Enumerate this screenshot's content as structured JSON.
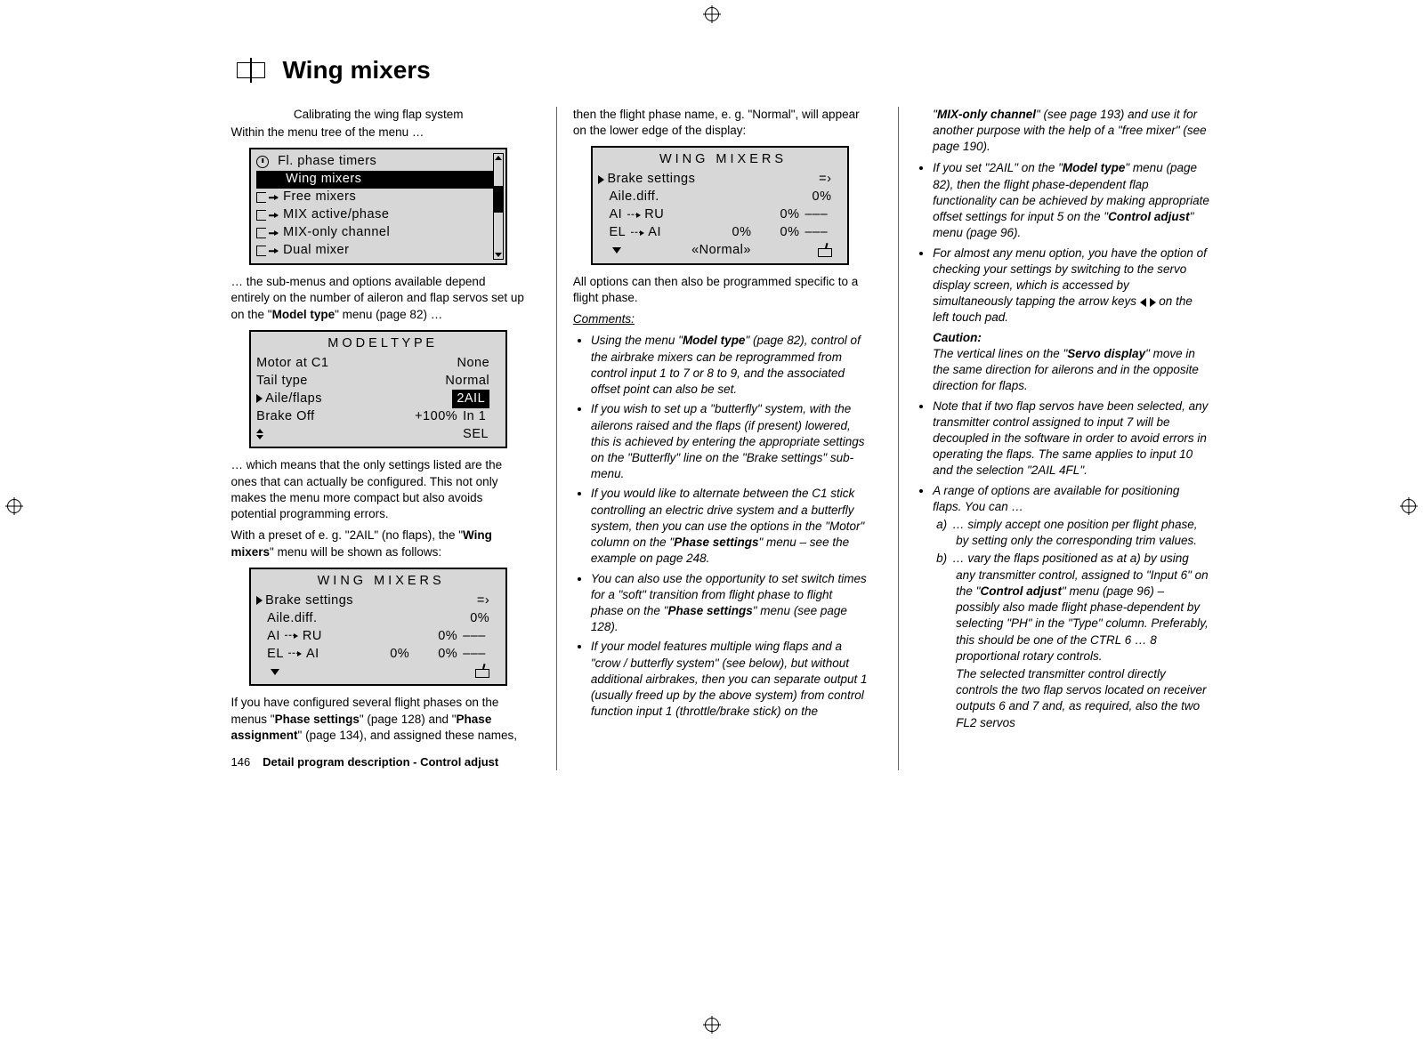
{
  "page": {
    "title": "Wing mixers",
    "subtitle": "Calibrating the wing flap system",
    "footer_page": "146",
    "footer_text": "Detail program description - Control adjust"
  },
  "col1": {
    "intro": "Within the menu tree of the menu …",
    "menu": {
      "items": [
        "Fl. phase timers",
        "Wing mixers",
        "Free mixers",
        "MIX active/phase",
        "MIX-only channel",
        "Dual mixer"
      ]
    },
    "after_menu_1": "… the sub-menus and options available depend entirely on the number of aileron and flap servos set up on the \"",
    "after_menu_1_bold": "Model type",
    "after_menu_1_end": "\" menu (page 82) …",
    "model_type": {
      "title": "M O D E L  T Y P E",
      "rows": [
        {
          "label": "Motor at C1",
          "val": "None"
        },
        {
          "label": "Tail  type",
          "val": "Normal"
        },
        {
          "label": "Aile/flaps",
          "val": "2AIL",
          "selected": true,
          "boxed": true
        },
        {
          "label": "Brake Off",
          "val": "+100%",
          "sw": "In 1"
        },
        {
          "label": "",
          "val": "",
          "sw": "SEL",
          "updn": true
        }
      ]
    },
    "after_model_1": "… which means that the only settings listed are the ones that can actually be configured. This not only makes the menu more compact but also avoids potential programming errors.",
    "after_model_2a": "With a preset of e. g. \"2AIL\" (no flaps), the \"",
    "after_model_2b": "Wing mixers",
    "after_model_2c": "\" menu will be shown as follows:",
    "wing1": {
      "title": "WING  MIXERS",
      "rows": [
        {
          "sel": true,
          "label": "Brake settings",
          "val": "",
          "arrow": true
        },
        {
          "label": "Aile.diff.",
          "val": "0%"
        },
        {
          "label": "AI",
          "to": "RU",
          "val": "0%",
          "dash": "–––"
        },
        {
          "label": "EL",
          "to": "AI",
          "mid": "0%",
          "val": "0%",
          "dash": "–––"
        },
        {
          "foot": true
        }
      ]
    },
    "tail_a": "If you have configured several flight phases on the menus \"",
    "tail_b": "Phase settings",
    "tail_c": "\" (page 128) and \"",
    "tail_d": "Phase assignment",
    "tail_e": "\" (page 134), and assigned these names,"
  },
  "col2": {
    "intro": "then the flight phase name, e. g. \"Normal\", will appear on the lower edge of the display:",
    "wing2": {
      "title": "WING  MIXERS",
      "rows": [
        {
          "sel": true,
          "label": "Brake settings",
          "val": "",
          "arrow": true
        },
        {
          "label": "Aile.diff.",
          "val": "0%"
        },
        {
          "label": "AI",
          "to": "RU",
          "val": "0%",
          "dash": "–––"
        },
        {
          "label": "EL",
          "to": "AI",
          "mid": "0%",
          "val": "0%",
          "dash": "–––"
        },
        {
          "foot": true,
          "footlabel": "«Normal»"
        }
      ]
    },
    "after": "All options can then also be programmed specific to a flight phase.",
    "comments_hdr": "Comments:",
    "bullets": [
      {
        "pre": "Using the menu \"",
        "bold": "Model type",
        "post": "\" (page 82), control of the airbrake mixers can be reprogrammed from control input 1 to 7 or 8 to 9, and the associated offset point can also be set."
      },
      {
        "plain": "If you wish to set up a \"butterfly\" system, with the ailerons raised and the flaps (if present) lowered, this is achieved by entering the appropriate settings on the \"Butterfly\" line on the \"Brake settings\" sub-menu."
      },
      {
        "pre": "If you would like to alternate between the C1 stick controlling an electric drive system and a butterfly system, then you can use the options in the \"Motor\" column on the \"",
        "bold": "Phase settings",
        "post": "\" menu – see the example on page 248."
      },
      {
        "pre": "You can also use the opportunity to set switch times for a \"soft\" transition from flight phase to flight phase on the \"",
        "bold": "Phase settings",
        "post": "\" menu (see page 128)."
      },
      {
        "plain": "If your model features multiple wing flaps and a \"crow / butterfly system\" (see below), but without additional airbrakes, then you can separate output 1 (usually freed up by the above system) from control function input 1 (throttle/brake stick) on the"
      }
    ]
  },
  "col3": {
    "lead": {
      "pre": "\"",
      "b": "MIX-only channel",
      "post": "\" (see page 193) and use it for another purpose with the help of a \"free mixer\" (see page 190)."
    },
    "bul1": {
      "pre": "If you set \"2AIL\" on the \"",
      "b1": "Model type",
      "mid": "\" menu (page 82), then the flight phase-dependent flap functionality can be achieved by making appropriate offset settings for input 5 on the \"",
      "b2": "Control adjust",
      "post": "\" menu (page 96)."
    },
    "bul2": {
      "pre": "For almost any menu option, you have the option of checking your settings by switching to the servo display screen, which is accessed by simultaneously tapping the arrow keys ",
      "post": " on the left touch pad."
    },
    "caution_hdr": "Caution:",
    "caution_body": {
      "pre": "The vertical lines on the \"",
      "b": "Servo display",
      "post": "\" move in the same direction for ailerons and in the opposite direction for flaps."
    },
    "bul3": "Note that if two flap servos have been selected, any transmitter control assigned to input 7 will be decoupled in the software in order to avoid errors in operating the flaps. The same applies to input 10 and the selection \"2AIL 4FL\".",
    "bul4": "A range of options are available for positioning flaps. You can …",
    "sub_a_lab": "a)",
    "sub_a": "… simply accept one position per flight phase, by setting only the corresponding trim values.",
    "sub_b_lab": "b)",
    "sub_b": {
      "pre": "… vary the flaps positioned as at a) by using any transmitter control, assigned to \"Input 6\" on the \"",
      "b": "Control adjust",
      "post": "\" menu (page 96) – possibly also made flight phase-dependent by selecting \"PH\" in the \"Type\" column. Preferably, this should be one of the CTRL 6 … 8 proportional rotary controls."
    },
    "sub_b_extra": "The selected transmitter control directly controls the two flap servos located on receiver outputs 6 and 7 and, as required, also the two FL2 servos"
  }
}
